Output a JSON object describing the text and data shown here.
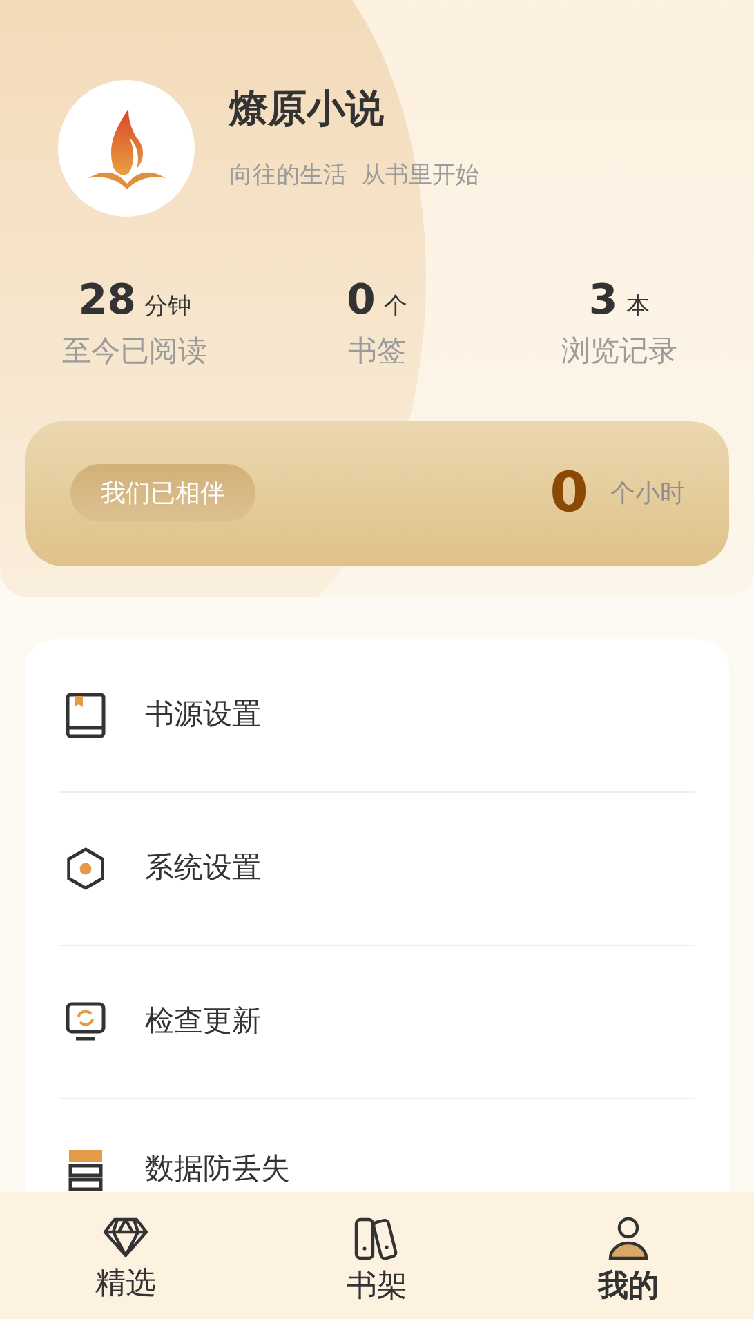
{
  "profile": {
    "name": "燎原小说",
    "slogan": "向往的生活  从书里开始"
  },
  "stats": [
    {
      "value": "28",
      "unit": "分钟",
      "label": "至今已阅读"
    },
    {
      "value": "0",
      "unit": "个",
      "label": "书签"
    },
    {
      "value": "3",
      "unit": "本",
      "label": "浏览记录"
    }
  ],
  "companion": {
    "label": "我们已相伴",
    "value": "0",
    "unit": "个小时"
  },
  "menu": [
    {
      "kind": "book",
      "label": "书源设置"
    },
    {
      "kind": "hexagon",
      "label": "系统设置"
    },
    {
      "kind": "update",
      "label": "检查更新"
    },
    {
      "kind": "storage",
      "label": "数据防丢失"
    }
  ],
  "tabs": [
    {
      "kind": "diamond",
      "label": "精选",
      "selected": false
    },
    {
      "kind": "shelf",
      "label": "书架",
      "selected": false
    },
    {
      "kind": "person",
      "label": "我的",
      "selected": true
    }
  ]
}
